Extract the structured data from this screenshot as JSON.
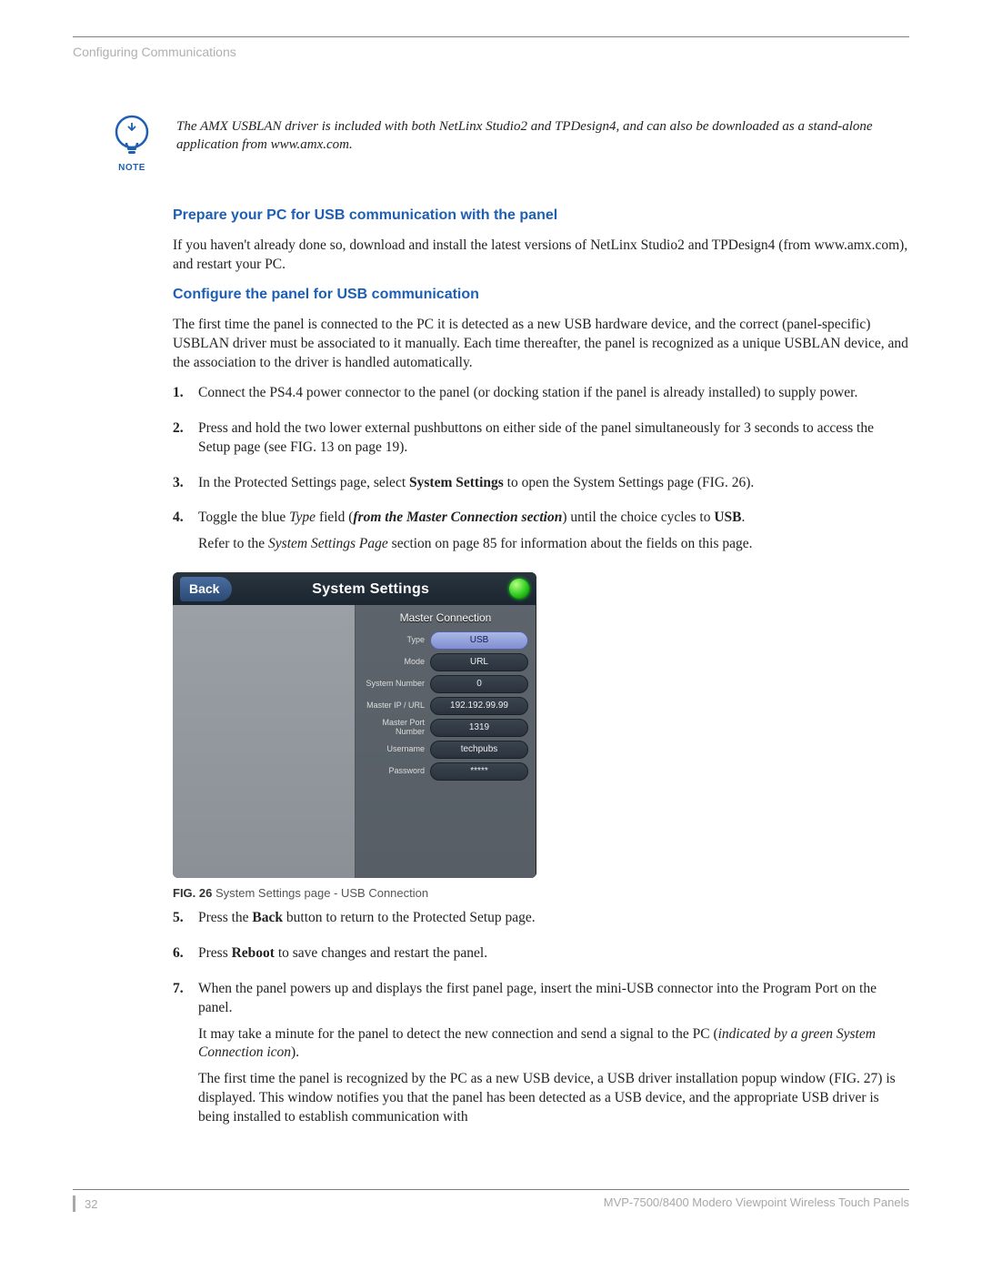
{
  "header": {
    "section": "Configuring Communications"
  },
  "note": {
    "label": "NOTE",
    "text": "The AMX USBLAN driver is included with both NetLinx Studio2 and TPDesign4, and can also be downloaded as a stand-alone application from www.amx.com."
  },
  "h_prepare": "Prepare your PC for USB communication with the panel",
  "p_prepare": "If you haven't already done so, download and install the latest versions of NetLinx Studio2 and TPDesign4 (from www.amx.com), and restart your PC.",
  "h_configure": "Configure the panel for USB communication",
  "p_configure": "The first time the panel is connected to the PC it is detected as a new USB hardware device, and the correct (panel-specific) USBLAN driver must be associated to it manually. Each time thereafter, the panel is recognized as a unique USBLAN device, and the association to the driver is handled automatically.",
  "steps_a": {
    "s1": "Connect the PS4.4 power connector to the panel (or docking station if the panel is already installed) to supply power.",
    "s2": "Press and hold the two lower external pushbuttons on either side of the panel simultaneously for 3 seconds to access the Setup page (see FIG. 13 on page 19).",
    "s3_pre": "In the Protected Settings page, select ",
    "s3_b": "System Settings",
    "s3_post": " to open the System Settings page (FIG. 26).",
    "s4_pre": "Toggle the blue ",
    "s4_i1": "Type",
    "s4_mid": " field (",
    "s4_bi": "from the Master Connection section",
    "s4_post1": ") until the choice cycles to ",
    "s4_b2": "USB",
    "s4_post2": ".",
    "s4_para2_pre": "Refer to the ",
    "s4_para2_i": "System Settings Page",
    "s4_para2_post": " section on page 85 for information about the fields on this page."
  },
  "screenshot": {
    "back": "Back",
    "title": "System Settings",
    "section": "Master Connection",
    "rows": [
      {
        "label": "Type",
        "value": "USB",
        "selected": true
      },
      {
        "label": "Mode",
        "value": "URL"
      },
      {
        "label": "System Number",
        "value": "0"
      },
      {
        "label": "Master IP / URL",
        "value": "192.192.99.99"
      },
      {
        "label": "Master Port Number",
        "value": "1319"
      },
      {
        "label": "Username",
        "value": "techpubs"
      },
      {
        "label": "Password",
        "value": "*****"
      }
    ]
  },
  "fig_caption": {
    "label": "FIG. 26",
    "text": "  System Settings page - USB Connection"
  },
  "steps_b": {
    "s5_pre": "Press the ",
    "s5_b": "Back",
    "s5_post": " button to return to the Protected Setup page.",
    "s6_pre": "Press ",
    "s6_b": "Reboot",
    "s6_post": " to save changes and restart the panel.",
    "s7_p1": "When the panel powers up and displays the first panel page, insert the mini-USB connector into the Program Port on the panel.",
    "s7_p2_pre": "It may take a minute for the panel to detect the new connection and send a signal to the PC (",
    "s7_p2_i": "indicated by a green System Connection icon",
    "s7_p2_post": ").",
    "s7_p3": "The first time the panel is recognized by the PC as a new USB device, a USB driver installation popup window (FIG. 27) is displayed. This window notifies you that the panel has been detected as a USB device, and the appropriate USB driver is being installed to establish communication with"
  },
  "footer": {
    "page": "32",
    "doc": "MVP-7500/8400 Modero Viewpoint Wireless Touch Panels"
  }
}
